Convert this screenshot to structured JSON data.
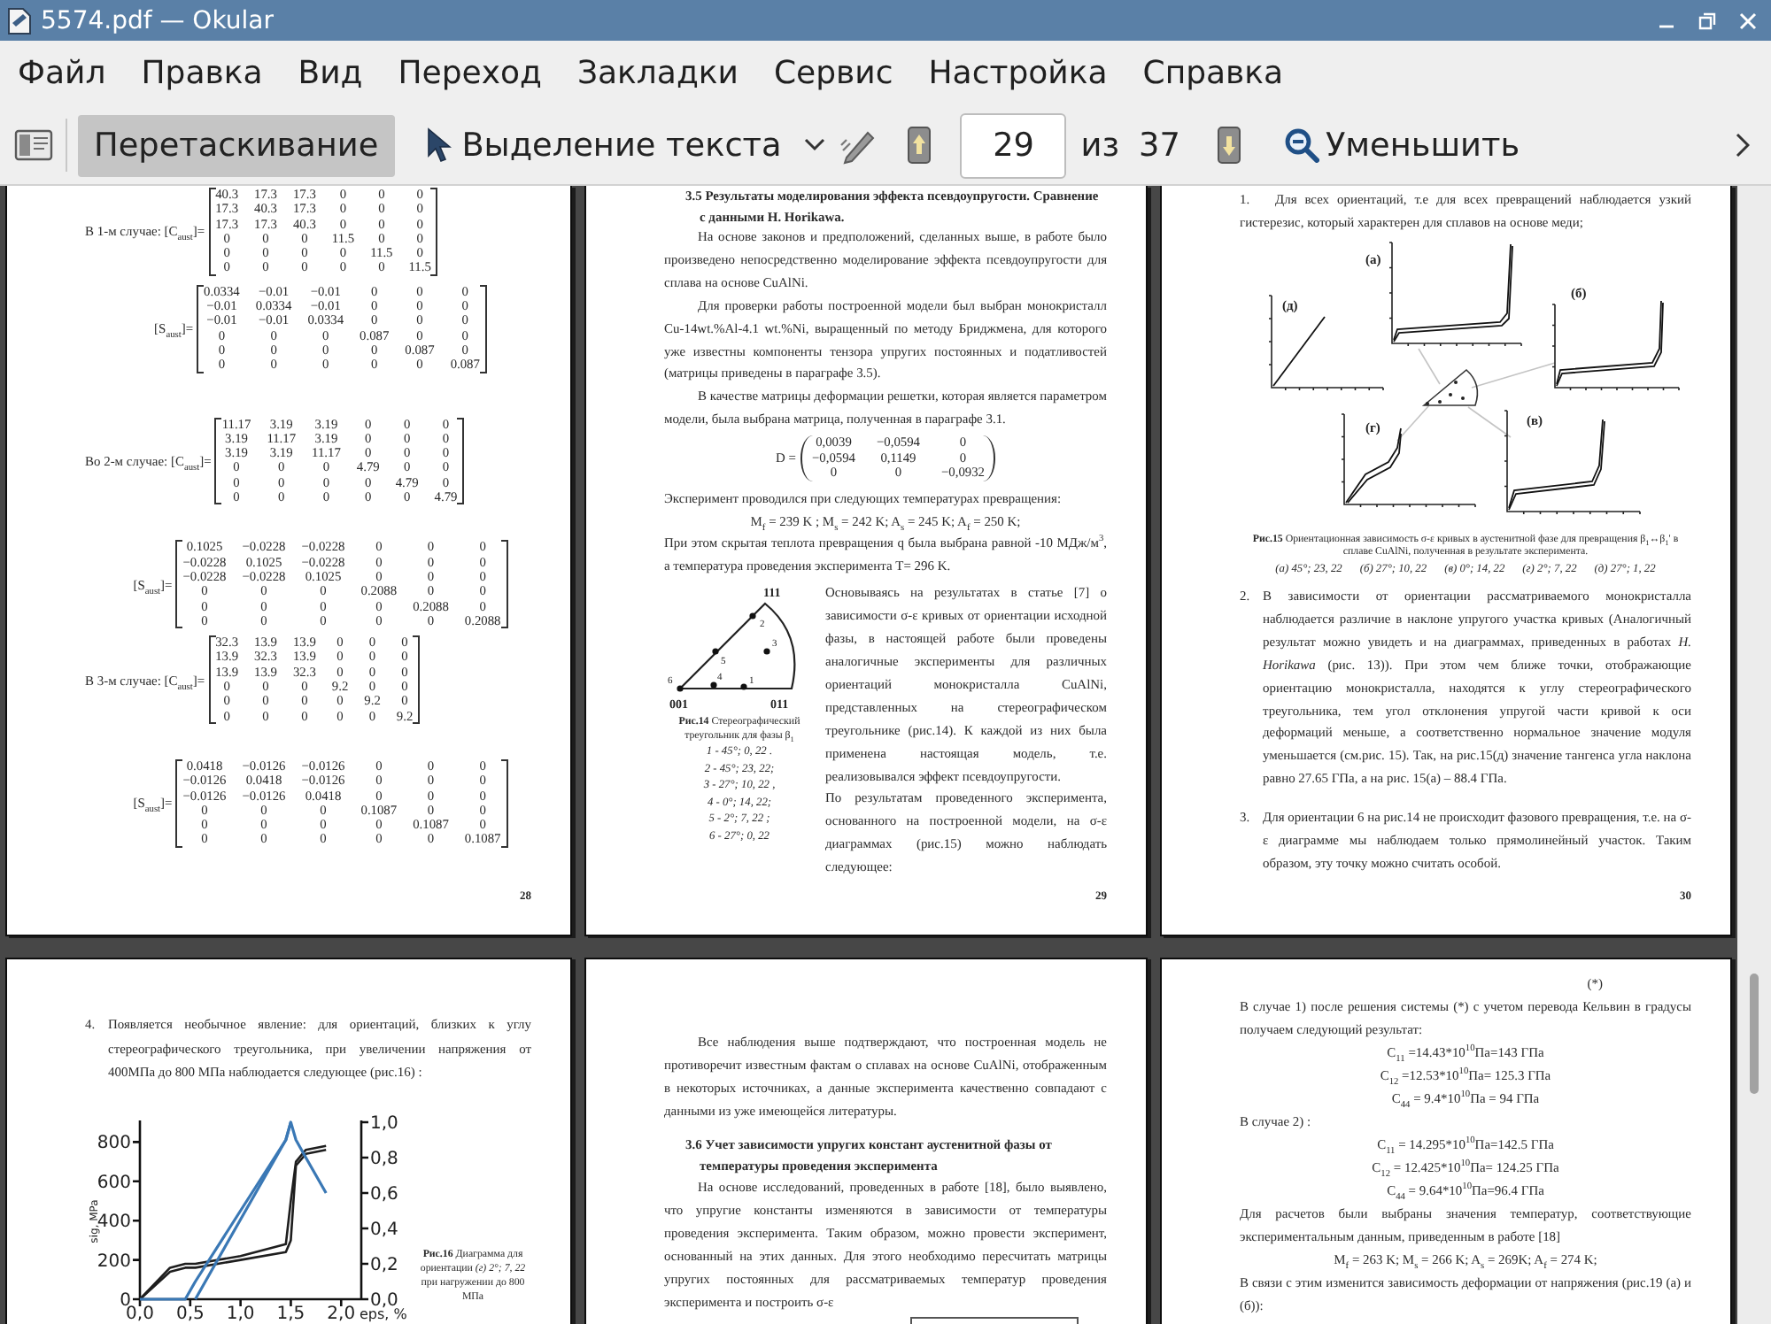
{
  "window": {
    "title": "5574.pdf — Okular"
  },
  "menu": [
    "Файл",
    "Правка",
    "Вид",
    "Переход",
    "Закладки",
    "Сервис",
    "Настройка",
    "Справка"
  ],
  "toolbar": {
    "mode_buttons": [
      {
        "kind": "drag",
        "label": "Перетаскивание",
        "selected": true
      },
      {
        "kind": "text_select",
        "label": "Выделение текста",
        "selected": false
      }
    ],
    "page_field": {
      "value": "29"
    },
    "page_separator": "из",
    "page_count": "37",
    "zoom_button": {
      "label": "Уменьшить"
    }
  },
  "pages": [
    {
      "number": "28",
      "blocks": [
        {
          "kind": "matrix",
          "label": "В 1-м случае: [C$_{aust}$]=",
          "rows": [
            [
              "40.3",
              "17.3",
              "17.3",
              "0",
              "0",
              "0"
            ],
            [
              "17.3",
              "40.3",
              "17.3",
              "0",
              "0",
              "0"
            ],
            [
              "17.3",
              "17.3",
              "40.3",
              "0",
              "0",
              "0"
            ],
            [
              "0",
              "0",
              "0",
              "11.5",
              "0",
              "0"
            ],
            [
              "0",
              "0",
              "0",
              "0",
              "11.5",
              "0"
            ],
            [
              "0",
              "0",
              "0",
              "0",
              "0",
              "11.5"
            ]
          ]
        },
        {
          "kind": "matrix",
          "label": "[S$_{aust}$]=",
          "rows": [
            [
              "0.0334",
              "−0.01",
              "−0.01",
              "0",
              "0",
              "0"
            ],
            [
              "−0.01",
              "0.0334",
              "−0.01",
              "0",
              "0",
              "0"
            ],
            [
              "−0.01",
              "−0.01",
              "0.0334",
              "0",
              "0",
              "0"
            ],
            [
              "0",
              "0",
              "0",
              "0.087",
              "0",
              "0"
            ],
            [
              "0",
              "0",
              "0",
              "0",
              "0.087",
              "0"
            ],
            [
              "0",
              "0",
              "0",
              "0",
              "0",
              "0.087"
            ]
          ]
        },
        {
          "kind": "matrix",
          "label": "Во 2-м случае: [C$_{aust}$]=",
          "rows": [
            [
              "11.17",
              "3.19",
              "3.19",
              "0",
              "0",
              "0"
            ],
            [
              "3.19",
              "11.17",
              "3.19",
              "0",
              "0",
              "0"
            ],
            [
              "3.19",
              "3.19",
              "11.17",
              "0",
              "0",
              "0"
            ],
            [
              "0",
              "0",
              "0",
              "4.79",
              "0",
              "0"
            ],
            [
              "0",
              "0",
              "0",
              "0",
              "4.79",
              "0"
            ],
            [
              "0",
              "0",
              "0",
              "0",
              "0",
              "4.79"
            ]
          ]
        },
        {
          "kind": "matrix",
          "label": "[S$_{aust}$]=",
          "rows": [
            [
              "0.1025",
              "−0.0228",
              "−0.0228",
              "0",
              "0",
              "0"
            ],
            [
              "−0.0228",
              "0.1025",
              "−0.0228",
              "0",
              "0",
              "0"
            ],
            [
              "−0.0228",
              "−0.0228",
              "0.1025",
              "0",
              "0",
              "0"
            ],
            [
              "0",
              "0",
              "0",
              "0.2088",
              "0",
              "0"
            ],
            [
              "0",
              "0",
              "0",
              "0",
              "0.2088",
              "0"
            ],
            [
              "0",
              "0",
              "0",
              "0",
              "0",
              "0.2088"
            ]
          ]
        },
        {
          "kind": "matrix",
          "label": "В 3-м случае: [C$_{aust}$]=",
          "rows": [
            [
              "32.3",
              "13.9",
              "13.9",
              "0",
              "0",
              "0"
            ],
            [
              "13.9",
              "32.3",
              "13.9",
              "0",
              "0",
              "0"
            ],
            [
              "13.9",
              "13.9",
              "32.3",
              "0",
              "0",
              "0"
            ],
            [
              "0",
              "0",
              "0",
              "9.2",
              "0",
              "0"
            ],
            [
              "0",
              "0",
              "0",
              "0",
              "9.2",
              "0"
            ],
            [
              "0",
              "0",
              "0",
              "0",
              "0",
              "9.2"
            ]
          ]
        },
        {
          "kind": "matrix",
          "label": "[S$_{aust}$]=",
          "rows": [
            [
              "0.0418",
              "−0.0126",
              "−0.0126",
              "0",
              "0",
              "0"
            ],
            [
              "−0.0126",
              "0.0418",
              "−0.0126",
              "0",
              "0",
              "0"
            ],
            [
              "−0.0126",
              "−0.0126",
              "0.0418",
              "0",
              "0",
              "0"
            ],
            [
              "0",
              "0",
              "0",
              "0.1087",
              "0",
              "0"
            ],
            [
              "0",
              "0",
              "0",
              "0",
              "0.1087",
              "0"
            ],
            [
              "0",
              "0",
              "0",
              "0",
              "0",
              "0.1087"
            ]
          ]
        }
      ]
    },
    {
      "number": "29",
      "blocks": [
        {
          "kind": "heading",
          "text": "3.5 Результаты моделирования эффекта псевдоупругости. Сравнение с данными H. Horikawa."
        },
        {
          "kind": "paragraph",
          "text": "На основе законов и предположений, сделанных выше, в работе было произведено непосредственно моделирование эффекта псевдоупругости для сплава на основе CuAlNi."
        },
        {
          "kind": "paragraph",
          "text": "Для проверки работы построенной модели был выбран монокристалл Cu-14wt.%Al-4.1 wt.%Ni, выращенный по методу Бриджмена, для которого уже известны компоненты тензора упругих постоянных и податливостей (матрицы приведены в параграфе 3.5)."
        },
        {
          "kind": "paragraph",
          "text": "В качестве матрицы деформации решетки, которая является параметром модели, была выбрана матрица, полученная в параграфе 3.1."
        },
        {
          "kind": "paren_matrix",
          "label": "D =",
          "rows": [
            [
              "0,0039",
              "−0,0594",
              "0"
            ],
            [
              "−0,0594",
              "0,1149",
              "0"
            ],
            [
              "0",
              "0",
              "−0,0932"
            ]
          ]
        },
        {
          "kind": "text",
          "text": "Эксперимент проводился при следующих температурах превращения:"
        },
        {
          "kind": "equation",
          "text": "M$_{f}$ = 239 K ; M$_{s}$ = 242 K; A$_{s}$ = 245 K; A$_{f}$ = 250 K;"
        },
        {
          "kind": "text",
          "text": "При этом скрытая теплота превращения q была выбрана равной -10 МДж/м$^{3}$, а температура проведения эксперимента T= 296 K."
        },
        {
          "kind": "figure_text",
          "figure": {
            "vertices": [
              "111",
              "001",
              "011"
            ],
            "points": [
              "1",
              "2",
              "3",
              "4",
              "5",
              "6"
            ],
            "caption": "**Рис.14** Стереографический треугольник для фазы β$_{1}$",
            "orientations": [
              "1 - 45°; 0, 22 .",
              "2 - 45°; 23, 22;",
              "3 - 27°; 10, 22 ,",
              "4 - 0°; 14, 22;",
              "5 - 2°; 7, 22 ;",
              "6 - 27°; 0, 22"
            ]
          },
          "paragraphs": [
            "Основываясь на результатах в статье [7] о зависимости σ-ε кривых от ориентации исходной фазы, в настоящей работе были проведены аналогичные эксперименты для различных ориентаций монокристалла CuAlNi, представленных на стереографическом треугольнике (рис.14). К каждой из них была применена настоящая модель, т.е. реализовывался эффект псевдоупругости.",
            "По результатам проведенного эксперимента, основанного на построенной модели, на σ-ε диаграммах (рис.15) можно наблюдать следующее:"
          ]
        }
      ]
    },
    {
      "number": "30",
      "blocks": [
        {
          "kind": "inline_item",
          "marker": "1.",
          "text": "Для всех ориентаций, т.е для всех превращений наблюдается узкий гистерезис, который характерен для сплавов на основе меди;"
        },
        {
          "kind": "panel_figure",
          "panels": [
            {
              "label": "(а)"
            },
            {
              "label": "(б)"
            },
            {
              "label": "(в)"
            },
            {
              "label": "(г)"
            },
            {
              "label": "(д)"
            }
          ],
          "caption": "**Рис.15** Ориентационная зависимость σ-ε кривых в аустенитной фазе для превращения β$_{1}$↔β$_{1}$' в сплаве CuAlNi, полученная в результате эксперимента.",
          "legend": [
            "(а) 45°; 23, 22",
            "(б) 27°; 10, 22",
            "(в) 0°; 14, 22",
            "(г) 2°; 7, 22",
            "(д) 27°; 1, 22"
          ]
        },
        {
          "kind": "list_item",
          "marker": "2.",
          "text": "В зависимости от ориентации рассматриваемого монокристалла наблюдается различие в наклоне упругого участка кривых (Аналогичный результат можно увидеть и на диаграммах, приведенных в работах *H. Horikawa* (рис. 13)). При этом чем ближе точки, отображающие ориентацию монокристалла, находятся к углу стереографического треугольника, тем угол отклонения упругой части кривой к оси деформаций меньше, а соответственно нормальное значение модуля уменьшается (см.рис. 15). Так, на рис.15(д) значение тангенса угла наклона равно 27.65 ГПа, а на рис. 15(а) – 88.4 ГПа."
        },
        {
          "kind": "list_item",
          "marker": "3.",
          "text": "Для ориентации 6 на рис.14 не происходит фазового превращения, т.е. на σ-ε диаграмме мы наблюдаем только прямолинейный участок. Таким образом, эту точку можно считать особой."
        }
      ]
    },
    {
      "blocks": [
        {
          "kind": "list_item",
          "marker": "4.",
          "text": "Появляется необычное явление: для ориентаций, близких к углу стереографического треугольника, при увеличении напряжения от 400МПа до 800 МПа наблюдается следующее (рис.16) :"
        },
        {
          "kind": "chart_figure",
          "caption": "**Рис.16** Диаграмма для ориентации *(г) 2°; 7, 22* при нагружении до 800 МПа",
          "chart_data": {
            "type": "line",
            "xlabel": "eps, %",
            "ylabel": "sig, MPa",
            "x": [
              0,
              0.3,
              0.45,
              0.55,
              1.0,
              1.45,
              1.5,
              1.55,
              1.65,
              1.85
            ],
            "series": [
              {
                "color": "#1e1e1e",
                "values": [
                  0,
                  160,
                  180,
                  180,
                  220,
                  280,
                  500,
                  700,
                  760,
                  780
                ]
              },
              {
                "color": "#1e1e1e",
                "values": [
                  0,
                  140,
                  160,
                  160,
                  200,
                  240,
                  300,
                  680,
                  740,
                  760
                ]
              },
              {
                "color": "#3a78b5",
                "axis": "y2",
                "values": [
                  0,
                  0,
                  0,
                  0.1,
                  0.5,
                  0.9,
                  1.0,
                  0.9,
                  0.8,
                  0.6
                ]
              },
              {
                "color": "#3a78b5",
                "axis": "y2",
                "values": [
                  null,
                  null,
                  null,
                  0,
                  0.45,
                  0.9,
                  1.0,
                  null,
                  null,
                  null
                ]
              }
            ],
            "xlim": [
              0,
              2.2
            ],
            "ylim": [
              0,
              910
            ],
            "y2lim": [
              0,
              1.01
            ],
            "xticks": [
              {
                "value": 0,
                "label": "0,0"
              },
              {
                "value": 0.5,
                "label": "0,5"
              },
              {
                "value": 1,
                "label": "1,0"
              },
              {
                "value": 1.5,
                "label": "1,5"
              },
              {
                "value": 2,
                "label": "2,0"
              }
            ],
            "yticks": [
              0,
              200,
              400,
              600,
              800
            ],
            "y2ticks": [
              {
                "value": 0,
                "label": "0,0"
              },
              {
                "value": 0.2,
                "label": "0,2"
              },
              {
                "value": 0.4,
                "label": "0,4"
              },
              {
                "value": 0.6,
                "label": "0,6"
              },
              {
                "value": 0.8,
                "label": "0,8"
              },
              {
                "value": 1,
                "label": "1,0"
              }
            ]
          }
        }
      ]
    },
    {
      "blocks": [
        {
          "kind": "paragraph",
          "text": "Все наблюдения выше подтверждают, что построенная модель не противоречит известным фактам о сплавах на основе CuAlNi, отображенным в некоторых источниках, а данные эксперимента качественно совпадают с данными из уже имеющейся литературы."
        },
        {
          "kind": "heading",
          "text": "3.6 Учет зависимости упругих констант аустенитной фазы от температуры проведения эксперимента"
        },
        {
          "kind": "paragraph",
          "text": "На основе исследований, проведенных в работе [18], было выявлено, что упругие константы изменяются в зависимости от температуры проведения эксперимента. Таким образом, можно провести эксперимент, основанный на этих данных. Для этого необходимо пересчитать матрицы упругих постоянных для рассматриваемых температур проведения эксперимента и построить σ-ε"
        },
        {
          "kind": "formula_box"
        }
      ]
    },
    {
      "blocks": [
        {
          "kind": "eq_number",
          "text": "(*)"
        },
        {
          "kind": "text",
          "text": "В случае 1) после решения системы (*) с учетом перевода Кельвин в градусы получаем следующий результат:"
        },
        {
          "kind": "equation",
          "text": "C$_{11}$ =14.43*10$^{10}$Па=143 ГПа"
        },
        {
          "kind": "equation",
          "text": "C$_{12}$ =12.53*10$^{10}$Па= 125.3 ГПа"
        },
        {
          "kind": "equation",
          "text": "C$_{44}$ = 9.4*10$^{10}$Па = 94 ГПа"
        },
        {
          "kind": "text",
          "text": "В случае 2) :"
        },
        {
          "kind": "equation",
          "text": "C$_{11}$ = 14.295*10$^{10}$Па=142.5 ГПа"
        },
        {
          "kind": "equation",
          "text": "C$_{12}$ = 12.425*10$^{10}$Па= 124.25 ГПа"
        },
        {
          "kind": "equation",
          "text": "C$_{44}$ = 9.64*10$^{10}$Па=96.4 ГПа"
        },
        {
          "kind": "text",
          "text": "Для расчетов были выбраны значения температур, соответствующие экспериментальным данным, приведенным в работе [18]"
        },
        {
          "kind": "equation",
          "text": "M$_{f}$ = 263 K; M$_{s}$ = 266 K; A$_{s}$ = 269K; A$_{f}$ = 274 K;"
        },
        {
          "kind": "text",
          "text": "В связи с этим изменится зависимость деформации от напряжения (рис.19 (а) и (б)):"
        }
      ]
    }
  ]
}
